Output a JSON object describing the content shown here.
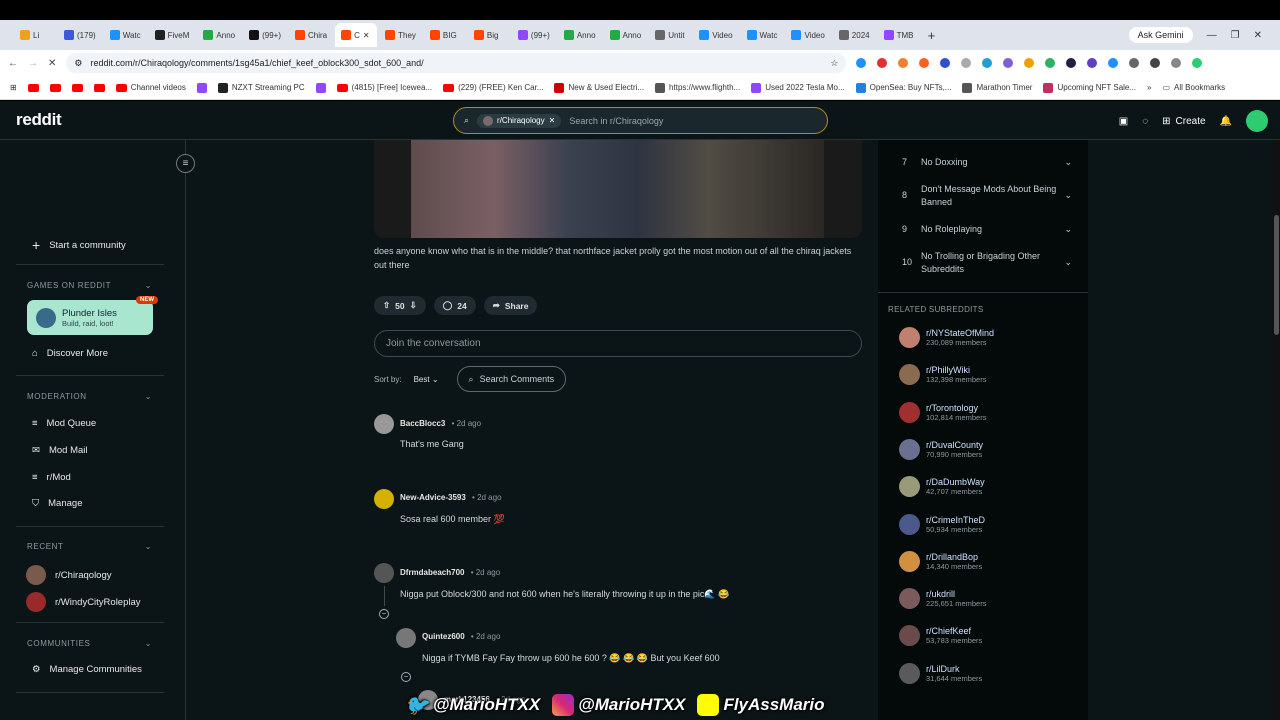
{
  "browser": {
    "tabs": [
      {
        "label": "Li",
        "color": "#f0a020"
      },
      {
        "label": "(179)",
        "color": "#3b5bdb"
      },
      {
        "label": "Watc",
        "color": "#1e90ff"
      },
      {
        "label": "FiveM",
        "color": "#222"
      },
      {
        "label": "Anno",
        "color": "#22aa44"
      },
      {
        "label": "(99+)",
        "color": "#111"
      },
      {
        "label": "Chira",
        "color": "#ff4500"
      },
      {
        "label": "C",
        "color": "#ff4500"
      },
      {
        "label": "They",
        "color": "#ff4500"
      },
      {
        "label": "BIG",
        "color": "#ff4500"
      },
      {
        "label": "Big",
        "color": "#ff4500"
      },
      {
        "label": "(99+)",
        "color": "#9146ff"
      },
      {
        "label": "Anno",
        "color": "#22aa44"
      },
      {
        "label": "Anno",
        "color": "#22aa44"
      },
      {
        "label": "Untit",
        "color": "#666"
      },
      {
        "label": "Video",
        "color": "#1e90ff"
      },
      {
        "label": "Watc",
        "color": "#1e90ff"
      },
      {
        "label": "Video",
        "color": "#1e90ff"
      },
      {
        "label": "2024",
        "color": "#666"
      },
      {
        "label": "TMB",
        "color": "#9146ff"
      }
    ],
    "new_tab": "+",
    "ask_gemini": "Ask Gemini",
    "url": "reddit.com/r/Chiraqology/comments/1sg45a1/chief_keef_oblock300_sdot_600_and/",
    "bookmarks": [
      {
        "label": "",
        "type": "yt"
      },
      {
        "label": "",
        "type": "yt"
      },
      {
        "label": "",
        "type": "yt"
      },
      {
        "label": "",
        "type": "yt"
      },
      {
        "label": "Channel videos",
        "type": "yt"
      },
      {
        "label": "",
        "type": "twitch"
      },
      {
        "label": "NZXT Streaming PC",
        "type": "nzxt"
      },
      {
        "label": "",
        "type": "twitch"
      },
      {
        "label": "(4815) [Free] Icewea...",
        "type": "yt"
      },
      {
        "label": "(229) (FREE) Ken Car...",
        "type": "yt"
      },
      {
        "label": "New & Used Electri...",
        "type": "tesla"
      },
      {
        "label": "https://www.flighth...",
        "type": "web"
      },
      {
        "label": "Used 2022 Tesla Mo...",
        "type": "purple"
      },
      {
        "label": "OpenSea: Buy NFTs,...",
        "type": "opensea"
      },
      {
        "label": "Marathon Timer",
        "type": "web"
      },
      {
        "label": "Upcoming NFT Sale...",
        "type": "nft"
      }
    ],
    "all_bookmarks": "All Bookmarks"
  },
  "header": {
    "logo": "reddit",
    "search_chip": "r/Chiraqology",
    "search_placeholder": "Search in r/Chiraqology",
    "create": "Create"
  },
  "sidebar": {
    "start_community": "Start a community",
    "games_head": "GAMES ON REDDIT",
    "game_title": "Plunder Isles",
    "game_sub": "Build, raid, loot!",
    "game_badge": "NEW",
    "discover": "Discover More",
    "moderation_head": "MODERATION",
    "mod_items": [
      "Mod Queue",
      "Mod Mail",
      "r/Mod",
      "Manage"
    ],
    "recent_head": "RECENT",
    "recent_items": [
      "r/Chiraqology",
      "r/WindyCityRoleplay"
    ],
    "communities_head": "COMMUNITIES",
    "manage_communities": "Manage Communities"
  },
  "post": {
    "body": "does anyone know who that is in the middle? that northface jacket prolly got the most motion out of all the chiraq jackets out there",
    "votes": "50",
    "comments": "24",
    "share": "Share",
    "join_placeholder": "Join the conversation",
    "sort_label": "Sort by:",
    "sort_value": "Best",
    "search_comments": "Search Comments"
  },
  "comments": [
    {
      "user": "BaccBlocc3",
      "time": "2d ago",
      "text": "That's me Gang",
      "color": "#999"
    },
    {
      "user": "New-Advice-3593",
      "time": "2d ago",
      "text": "Sosa real 600 member 💯",
      "color": "#d4b000"
    },
    {
      "user": "Dfrmdabeach700",
      "time": "2d ago",
      "text": "Nigga put Oblock/300 and not 600 when he's literally throwing it up in the pic🌊 😂",
      "color": "#555"
    },
    {
      "user": "Quintez600",
      "time": "2d ago",
      "text": "Nigga if TYMB Fay Fay throw up 600 he 600 ? 😂 😂 😂  But you Keef 600",
      "color": "#777"
    },
    {
      "user": "mark123456",
      "time": "2d ago",
      "text": "",
      "color": "#888"
    }
  ],
  "rules": [
    {
      "num": "7",
      "text": "No Doxxing"
    },
    {
      "num": "8",
      "text": "Don't Message Mods About Being Banned"
    },
    {
      "num": "9",
      "text": "No Roleplaying"
    },
    {
      "num": "10",
      "text": "No Trolling or Brigading Other Subreddits"
    }
  ],
  "related_head": "RELATED SUBREDDITS",
  "related": [
    {
      "name": "r/NYStateOfMind",
      "members": "230,089 members",
      "color": "#c08070"
    },
    {
      "name": "r/PhillyWiki",
      "members": "132,398 members",
      "color": "#8a6a50"
    },
    {
      "name": "r/Torontology",
      "members": "102,814 members",
      "color": "#a03030"
    },
    {
      "name": "r/DuvalCounty",
      "members": "70,990 members",
      "color": "#6a7090"
    },
    {
      "name": "r/DaDumbWay",
      "members": "42,707 members",
      "color": "#9a9a7a"
    },
    {
      "name": "r/CrimeInTheD",
      "members": "50,934 members",
      "color": "#4a5a8a"
    },
    {
      "name": "r/DrillandBop",
      "members": "14,340 members",
      "color": "#d09040"
    },
    {
      "name": "r/ukdrill",
      "members": "225,651 members",
      "color": "#7a5a5a"
    },
    {
      "name": "r/ChiefKeef",
      "members": "53,783 members",
      "color": "#6a4a4a"
    },
    {
      "name": "r/LilDurk",
      "members": "31,644 members",
      "color": "#5a5a5a"
    }
  ],
  "watermark": {
    "twitter": "@MarioHTXX",
    "instagram": "@MarioHTXX",
    "snapchat": "FlyAssMario"
  }
}
